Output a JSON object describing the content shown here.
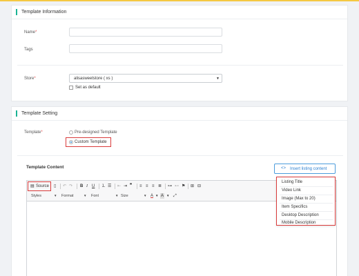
{
  "template_information": {
    "title": "Template Information",
    "name_label": "Name",
    "tags_label": "Tags",
    "store_label": "Store",
    "required_mark": "*",
    "store_value": "alisasweetstore ( xs )",
    "set_default_label": "Set as default"
  },
  "template_setting": {
    "title": "Template Setting",
    "template_label": "Template",
    "required_mark": "*",
    "options": [
      "Pre-designed Template",
      "Custom Template"
    ],
    "selected_option": "Custom Template",
    "content_label": "Template Content",
    "insert_button_label": "Insert listing content",
    "insert_icon": "<>",
    "insert_menu": [
      "Listing Title",
      "Video Link",
      "Image (Max to 20)",
      "Item Specifics",
      "Desktop Description",
      "Mobile Description"
    ]
  },
  "editor": {
    "source_label": "Source",
    "styles_label": "Styles",
    "format_label": "Format",
    "font_label": "Font",
    "size_label": "Size"
  },
  "colors": {
    "accent_bar": "#1ab394",
    "highlight_box": "#d93a3a",
    "link_blue": "#2a7fd0",
    "top_line": "#f5c842"
  }
}
